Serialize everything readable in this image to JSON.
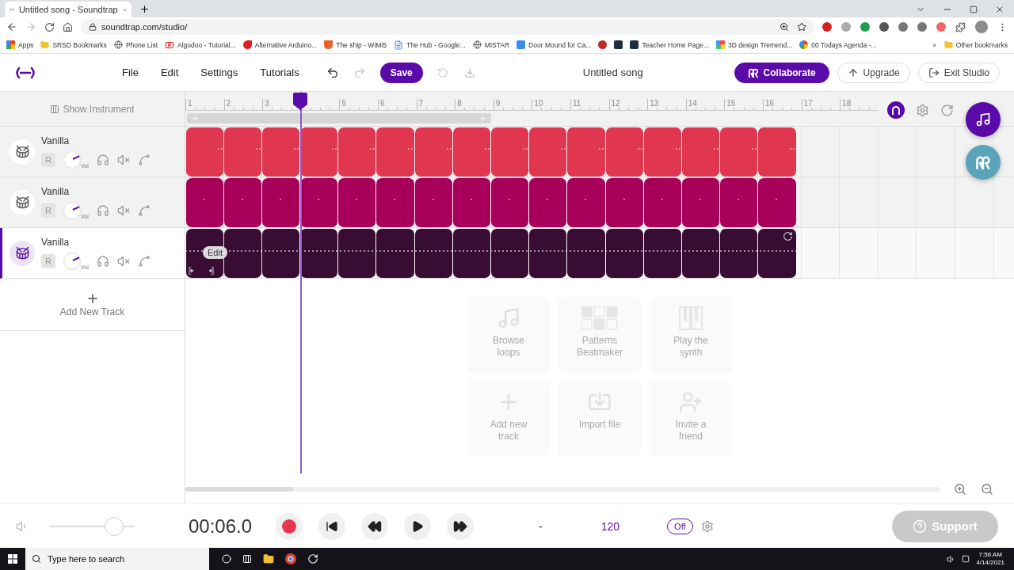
{
  "browser": {
    "tab_title": "Untitled song - Soundtrap",
    "url": "soundtrap.com/studio/",
    "bookmarks": [
      {
        "label": "Apps",
        "kind": "apps"
      },
      {
        "label": "SRSD Bookmarks",
        "kind": "folder"
      },
      {
        "label": "Phone List",
        "kind": "globe"
      },
      {
        "label": "Algodoo - Tutorial...",
        "kind": "video"
      },
      {
        "label": "Alternative Arduino...",
        "kind": "flame"
      },
      {
        "label": "The ship - WiMi5",
        "kind": "html"
      },
      {
        "label": "The Hub - Google...",
        "kind": "doc"
      },
      {
        "label": "MISTAR",
        "kind": "globe"
      },
      {
        "label": "Door Mound for Ca...",
        "kind": "badge"
      },
      {
        "kind": "ball"
      },
      {
        "kind": "grid"
      },
      {
        "label": "Teacher Home Page...",
        "kind": "grid"
      },
      {
        "label": "3D design Tremend...",
        "kind": "mosaic"
      },
      {
        "label": "00 Todays Agenda -...",
        "kind": "google"
      }
    ],
    "more": "»",
    "other_bookmarks": "Other bookmarks"
  },
  "header": {
    "menu": [
      "File",
      "Edit",
      "Settings",
      "Tutorials"
    ],
    "save": "Save",
    "song_title": "Untitled song",
    "buttons": [
      {
        "label": "Collaborate",
        "kind": "collaborate"
      },
      {
        "label": "Upgrade",
        "kind": "upgrade"
      },
      {
        "label": "Exit Studio",
        "kind": "exit"
      }
    ]
  },
  "studio": {
    "show_instrument": "Show Instrument",
    "ruler_before_playhead": [
      "1",
      "2",
      "3"
    ],
    "ruler_after_playhead": [
      "5",
      "6",
      "7",
      "8",
      "9",
      "10",
      "11",
      "12",
      "13",
      "14",
      "15",
      "16",
      "17",
      "18"
    ],
    "tracks": [
      {
        "name": "Vanilla",
        "selected": false,
        "color": "#e0364f",
        "record": "R",
        "vol": "Vol"
      },
      {
        "name": "Vanilla",
        "selected": false,
        "color": "#a8005a",
        "record": "R",
        "vol": "Vol"
      },
      {
        "name": "Vanilla",
        "selected": true,
        "color": "#380c33",
        "record": "R",
        "vol": "Vol",
        "edit_label": "Edit"
      }
    ],
    "add_track": "Add New Track",
    "shortcuts": [
      {
        "label": "Browse loops",
        "kind": "loops"
      },
      {
        "label": "Patterns Beatmaker",
        "kind": "patterns"
      },
      {
        "label": "Play the synth",
        "kind": "synth"
      },
      {
        "label": "Add new track",
        "kind": "add"
      },
      {
        "label": "Import file",
        "kind": "import"
      },
      {
        "label": "Invite a friend",
        "kind": "invite"
      }
    ]
  },
  "transport": {
    "volume": {
      "level": 0.76
    },
    "time": "00:06.0",
    "key": "-",
    "tempo": "120",
    "metronome": "Off",
    "support": "Support"
  },
  "taskbar": {
    "search_placeholder": "Type here to search",
    "time": "7:56 AM",
    "date": "4/14/2021"
  }
}
